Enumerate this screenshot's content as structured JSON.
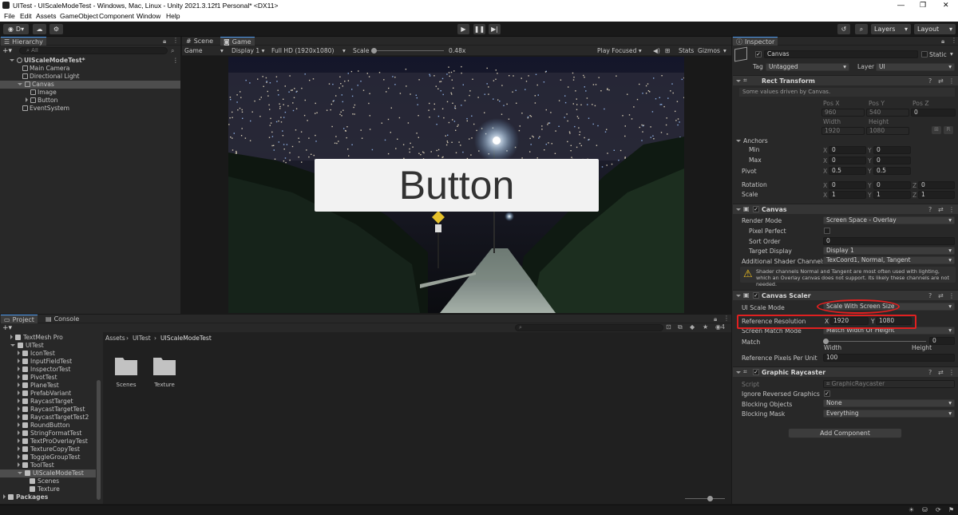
{
  "window": {
    "title": "UITest - UIScaleModeTest - Windows, Mac, Linux - Unity 2021.3.12f1 Personal* <DX11>",
    "controls": [
      "—",
      "❐",
      "✕"
    ]
  },
  "menu": [
    "File",
    "Edit",
    "Assets",
    "GameObject",
    "Component",
    "Window",
    "Help"
  ],
  "toolbar": {
    "account": "D",
    "layers": "Layers",
    "layout": "Layout"
  },
  "hierarchy": {
    "tab": "Hierarchy",
    "search_placeholder": "All",
    "items": [
      {
        "label": "UIScaleModeTest*",
        "level": 0
      },
      {
        "label": "Main Camera",
        "level": 1
      },
      {
        "label": "Directional Light",
        "level": 1
      },
      {
        "label": "Canvas",
        "level": 1
      },
      {
        "label": "Image",
        "level": 2
      },
      {
        "label": "Button",
        "level": 2
      },
      {
        "label": "EventSystem",
        "level": 1
      }
    ]
  },
  "game_view": {
    "tabs": [
      "Scene",
      "Game"
    ],
    "display_mode": "Game",
    "display": "Display 1",
    "resolution": "Full HD (1920x1080)",
    "scale_label": "Scale",
    "scale_value": "0.48x",
    "play_focused": "Play Focused",
    "stats": "Stats",
    "gizmos": "Gizmos",
    "button_text": "Button"
  },
  "project": {
    "tabs": [
      "Project",
      "Console"
    ],
    "hidden_count": "4",
    "tree": [
      {
        "label": "TextMesh Pro",
        "level": 1
      },
      {
        "label": "UITest",
        "level": 1
      },
      {
        "label": "IconTest",
        "level": 2
      },
      {
        "label": "InputFieldTest",
        "level": 2
      },
      {
        "label": "InspectorTest",
        "level": 2
      },
      {
        "label": "PivotTest",
        "level": 2
      },
      {
        "label": "PlaneTest",
        "level": 2
      },
      {
        "label": "PrefabVariant",
        "level": 2
      },
      {
        "label": "RaycastTarget",
        "level": 2
      },
      {
        "label": "RaycastTargetTest",
        "level": 2
      },
      {
        "label": "RaycastTargetTest2",
        "level": 2
      },
      {
        "label": "RoundButton",
        "level": 2
      },
      {
        "label": "StringFormatTest",
        "level": 2
      },
      {
        "label": "TextProOverlayTest",
        "level": 2
      },
      {
        "label": "TextureCopyTest",
        "level": 2
      },
      {
        "label": "ToggleGroupTest",
        "level": 2
      },
      {
        "label": "ToolTest",
        "level": 2
      },
      {
        "label": "UIScaleModeTest",
        "level": 2
      },
      {
        "label": "Scenes",
        "level": 3
      },
      {
        "label": "Texture",
        "level": 3
      },
      {
        "label": "Packages",
        "level": 0
      }
    ],
    "breadcrumb": [
      "Assets",
      "UITest",
      "UIScaleModeTest"
    ],
    "assets": [
      "Scenes",
      "Texture"
    ]
  },
  "inspector": {
    "tab": "Inspector",
    "object_name": "Canvas",
    "static": "Static",
    "tag_label": "Tag",
    "tag": "Untagged",
    "layer_label": "Layer",
    "layer": "UI",
    "rect_transform": {
      "title": "Rect Transform",
      "note": "Some values driven by Canvas.",
      "posx_label": "Pos X",
      "posy_label": "Pos Y",
      "posz_label": "Pos Z",
      "posx": "960",
      "posy": "540",
      "posz": "0",
      "width_label": "Width",
      "height_label": "Height",
      "width": "1920",
      "height": "1080",
      "anchors": "Anchors",
      "min": "Min",
      "max": "Max",
      "pivot": "Pivot",
      "rotation": "Rotation",
      "scale": "Scale",
      "x": "X",
      "y": "Y",
      "z": "Z",
      "min_x": "0",
      "min_y": "0",
      "max_x": "0",
      "max_y": "0",
      "pivot_x": "0.5",
      "pivot_y": "0.5",
      "rot_x": "0",
      "rot_y": "0",
      "rot_z": "0",
      "scale_x": "1",
      "scale_y": "1",
      "scale_z": "1",
      "r_btn": "R"
    },
    "canvas": {
      "title": "Canvas",
      "render_mode_label": "Render Mode",
      "render_mode": "Screen Space - Overlay",
      "pixel_perfect_label": "Pixel Perfect",
      "sort_order_label": "Sort Order",
      "sort_order": "0",
      "target_display_label": "Target Display",
      "target_display": "Display 1",
      "shader_channels_label": "Additional Shader Channels",
      "shader_channels": "TexCoord1, Normal, Tangent",
      "warning": "Shader channels Normal and Tangent are most often used with lighting, which an Overlay canvas does not support. Its likely these channels are not needed."
    },
    "canvas_scaler": {
      "title": "Canvas Scaler",
      "ui_scale_mode_label": "UI Scale Mode",
      "ui_scale_mode": "Scale With Screen Size",
      "ref_res_label": "Reference Resolution",
      "ref_x": "1920",
      "ref_y": "1080",
      "match_mode_label": "Screen Match Mode",
      "match_mode": "Match Width Or Height",
      "match_label": "Match",
      "match_value": "0",
      "match_level": 0,
      "width_label": "Width",
      "height_label": "Height",
      "ppu_label": "Reference Pixels Per Unit",
      "ppu": "100"
    },
    "graphic_raycaster": {
      "title": "Graphic Raycaster",
      "script_label": "Script",
      "script": "GraphicRaycaster",
      "ignore_label": "Ignore Reversed Graphics",
      "blocking_objects_label": "Blocking Objects",
      "blocking_objects": "None",
      "blocking_mask_label": "Blocking Mask",
      "blocking_mask": "Everything"
    },
    "add_component": "Add Component"
  },
  "colors": {
    "highlight": "#e02020",
    "accent": "#4f9cf0"
  }
}
